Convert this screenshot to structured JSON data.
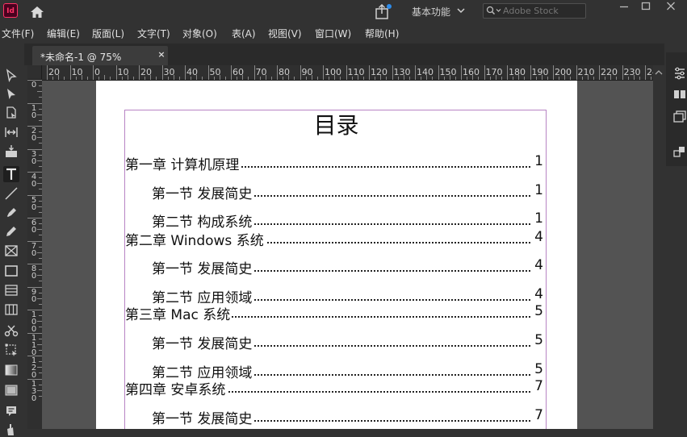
{
  "app": {
    "logo_text": "Id",
    "workspace": "基本功能",
    "search_placeholder": "Adobe Stock"
  },
  "menu": [
    "文件(F)",
    "编辑(E)",
    "版面(L)",
    "文字(T)",
    "对象(O)",
    "表(A)",
    "视图(V)",
    "窗口(W)",
    "帮助(H)"
  ],
  "tab": {
    "label": "*未命名-1 @ 75%",
    "close": "×"
  },
  "ruler": {
    "h": [
      "20",
      "10",
      "0",
      "10",
      "20",
      "30",
      "40",
      "50",
      "60",
      "70",
      "80",
      "90",
      "100",
      "110",
      "120",
      "130",
      "140",
      "150",
      "160",
      "170",
      "180",
      "190",
      "200",
      "210",
      "220",
      "230",
      "24"
    ],
    "v": [
      [
        "0"
      ],
      [
        "1",
        "0"
      ],
      [
        "2",
        "0"
      ],
      [
        "3",
        "0"
      ],
      [
        "4",
        "0"
      ],
      [
        "5",
        "0"
      ],
      [
        "6",
        "0"
      ],
      [
        "7",
        "0"
      ],
      [
        "8",
        "0"
      ],
      [
        "9",
        "0"
      ],
      [
        "1",
        "0",
        "0"
      ],
      [
        "1",
        "1",
        "0"
      ],
      [
        "1",
        "2",
        "0"
      ],
      [
        "1",
        "3",
        "0"
      ]
    ]
  },
  "toc": {
    "title": "目录",
    "entries": [
      {
        "label": "第一章 计算机原理",
        "page": "1",
        "level": 1
      },
      {
        "label": "第一节 发展简史",
        "page": "1",
        "level": 2
      },
      {
        "label": "第二节 构成系统",
        "page": "1",
        "level": 2
      },
      {
        "label": "第二章 Windows 系统",
        "page": "4",
        "level": 1
      },
      {
        "label": "第一节 发展简史",
        "page": "4",
        "level": 2
      },
      {
        "label": "第二节 应用领域",
        "page": "4",
        "level": 2
      },
      {
        "label": "第三章 Mac 系统",
        "page": "5",
        "level": 1
      },
      {
        "label": "第一节 发展简史",
        "page": "5",
        "level": 2
      },
      {
        "label": "第二节 应用领域",
        "page": "5",
        "level": 2
      },
      {
        "label": "第四章 安卓系统",
        "page": "7",
        "level": 1
      },
      {
        "label": "第一节 发展简史",
        "page": "7",
        "level": 2
      }
    ]
  },
  "tools": [
    "direct-arrow-icon",
    "selection-arrow-icon",
    "page-tool-icon",
    "gap-tool-icon",
    "content-collector-icon",
    "type-tool-icon",
    "line-tool-icon",
    "pen-tool-icon",
    "pencil-tool-icon",
    "rectangle-frame-icon",
    "rectangle-tool-icon",
    "table-icon",
    "grid-icon",
    "scissors-icon",
    "free-transform-icon",
    "gradient-swatch-icon",
    "gradient-feather-icon",
    "note-icon"
  ],
  "colors": {
    "accent": "#ff3366",
    "frame_border": "#b884c4",
    "ui_bg": "#323232"
  }
}
